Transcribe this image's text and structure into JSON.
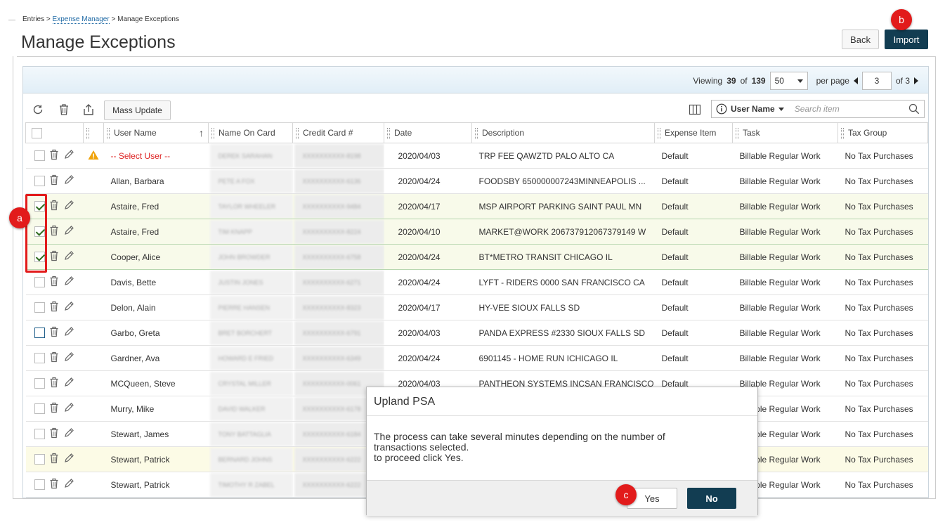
{
  "breadcrumb": {
    "entries": "Entries",
    "sep1": ">",
    "expense_manager": "Expense Manager",
    "sep2": ">",
    "current": "Manage Exceptions"
  },
  "page": {
    "title": "Manage Exceptions"
  },
  "header_buttons": {
    "back": "Back",
    "import": "Import"
  },
  "pager": {
    "viewing_label": "Viewing",
    "viewing_count": "39",
    "of_label": "of",
    "total": "139",
    "per_page_value": "50",
    "per_page_label": "per page",
    "current_page": "3",
    "page_of": "of 3"
  },
  "toolbar": {
    "icons": [
      "refresh-icon",
      "delete-icon",
      "export-icon",
      "columns-icon",
      "info-icon",
      "search-icon"
    ],
    "mass_update": "Mass Update",
    "search_field": "User Name",
    "search_placeholder": "Search item"
  },
  "table": {
    "columns": [
      "User Name",
      "Name On Card",
      "Credit Card #",
      "Date",
      "Description",
      "Expense Item",
      "Task",
      "Tax Group"
    ],
    "sort_indicator": "↑",
    "rows": [
      {
        "user": "-- Select User --",
        "name_on_card": "DEREK SARAHAN",
        "card": "XXXXXXXXXX-8198",
        "date": "2020/04/03",
        "desc": "TRP FEE QAWZTD PALO ALTO CA",
        "item": "Default",
        "task": "Billable Regular Work",
        "tax": "No Tax Purchases",
        "checked": false,
        "warning": true
      },
      {
        "user": "Allan, Barbara",
        "name_on_card": "PETE A FOX",
        "card": "XXXXXXXXXX-6136",
        "date": "2020/04/24",
        "desc": "FOODSBY 650000007243MINNEAPOLIS ...",
        "item": "Default",
        "task": "Billable Regular Work",
        "tax": "No Tax Purchases",
        "checked": false
      },
      {
        "user": "Astaire, Fred",
        "name_on_card": "TAYLOR WHEELER",
        "card": "XXXXXXXXXX-9484",
        "date": "2020/04/17",
        "desc": "MSP AIRPORT PARKING SAINT PAUL MN",
        "item": "Default",
        "task": "Billable Regular Work",
        "tax": "No Tax Purchases",
        "checked": true
      },
      {
        "user": "Astaire, Fred",
        "name_on_card": "TIM KNAPP",
        "card": "XXXXXXXXXX-8224",
        "date": "2020/04/10",
        "desc": "MARKET@WORK 206737912067379149 W",
        "item": "Default",
        "task": "Billable Regular Work",
        "tax": "No Tax Purchases",
        "checked": true
      },
      {
        "user": "Cooper, Alice",
        "name_on_card": "JOHN BROWDER",
        "card": "XXXXXXXXXX-6758",
        "date": "2020/04/24",
        "desc": "BT*METRO TRANSIT CHICAGO IL",
        "item": "Default",
        "task": "Billable Regular Work",
        "tax": "No Tax Purchases",
        "checked": true
      },
      {
        "user": "Davis, Bette",
        "name_on_card": "JUSTIN JONES",
        "card": "XXXXXXXXXX-6271",
        "date": "2020/04/24",
        "desc": "LYFT - RIDERS 0000 SAN FRANCISCO CA",
        "item": "Default",
        "task": "Billable Regular Work",
        "tax": "No Tax Purchases",
        "checked": false
      },
      {
        "user": "Delon, Alain",
        "name_on_card": "PIERRE HANSEN",
        "card": "XXXXXXXXXX-8323",
        "date": "2020/04/17",
        "desc": "HY-VEE SIOUX FALLS SD",
        "item": "Default",
        "task": "Billable Regular Work",
        "tax": "No Tax Purchases",
        "checked": false
      },
      {
        "user": "Garbo, Greta",
        "name_on_card": "BRET BORCHERT",
        "card": "XXXXXXXXXX-6791",
        "date": "2020/04/03",
        "desc": "PANDA EXPRESS #2330 SIOUX FALLS SD",
        "item": "Default",
        "task": "Billable Regular Work",
        "tax": "No Tax Purchases",
        "checked": false,
        "blue": true
      },
      {
        "user": "Gardner, Ava",
        "name_on_card": "HOWARD E FRIED",
        "card": "XXXXXXXXXX-6349",
        "date": "2020/04/24",
        "desc": "6901145 - HOME RUN ICHICAGO IL",
        "item": "Default",
        "task": "Billable Regular Work",
        "tax": "No Tax Purchases",
        "checked": false
      },
      {
        "user": "MCQueen, Steve",
        "name_on_card": "CRYSTAL MILLER",
        "card": "XXXXXXXXXX-0061",
        "date": "2020/04/03",
        "desc": "PANTHEON SYSTEMS INCSAN FRANCISCO",
        "item": "Default",
        "task": "Billable Regular Work",
        "tax": "No Tax Purchases",
        "checked": false
      },
      {
        "user": "Murry, Mike",
        "name_on_card": "DAVID WALKER",
        "card": "XXXXXXXXXX-6178",
        "date": "",
        "desc": "",
        "item": "",
        "task": "Billable Regular Work",
        "tax": "No Tax Purchases",
        "checked": false
      },
      {
        "user": "Stewart, James",
        "name_on_card": "TONY BATTAGLIA",
        "card": "XXXXXXXXXX-6184",
        "date": "",
        "desc": "",
        "item": "",
        "task": "Billable Regular Work",
        "tax": "No Tax Purchases",
        "checked": false
      },
      {
        "user": "Stewart, Patrick",
        "name_on_card": "BERNARD JOHNS",
        "card": "XXXXXXXXXX-6222",
        "date": "",
        "desc": "",
        "item": "",
        "task": "Billable Regular Work",
        "tax": "No Tax Purchases",
        "checked": false,
        "yellow": true
      },
      {
        "user": "Stewart, Patrick",
        "name_on_card": "TIMOTHY R ZABEL",
        "card": "XXXXXXXXXX-6222",
        "date": "",
        "desc": "",
        "item": "",
        "task": "Billable Regular Work",
        "tax": "No Tax Purchases",
        "checked": false
      }
    ]
  },
  "dialog": {
    "title": "Upland PSA",
    "message_line1": "The process can take several minutes depending on the number of",
    "message_line2": "transactions selected.",
    "message_line3": "to proceed click Yes.",
    "yes": "Yes",
    "no": "No"
  },
  "markers": {
    "a": "a",
    "b": "b",
    "c": "c"
  },
  "colors": {
    "primary": "#123d52",
    "annotation": "#e21b1b",
    "link": "#1f6aa5",
    "warning": "#f0a30a",
    "check": "#2e6b1e"
  }
}
